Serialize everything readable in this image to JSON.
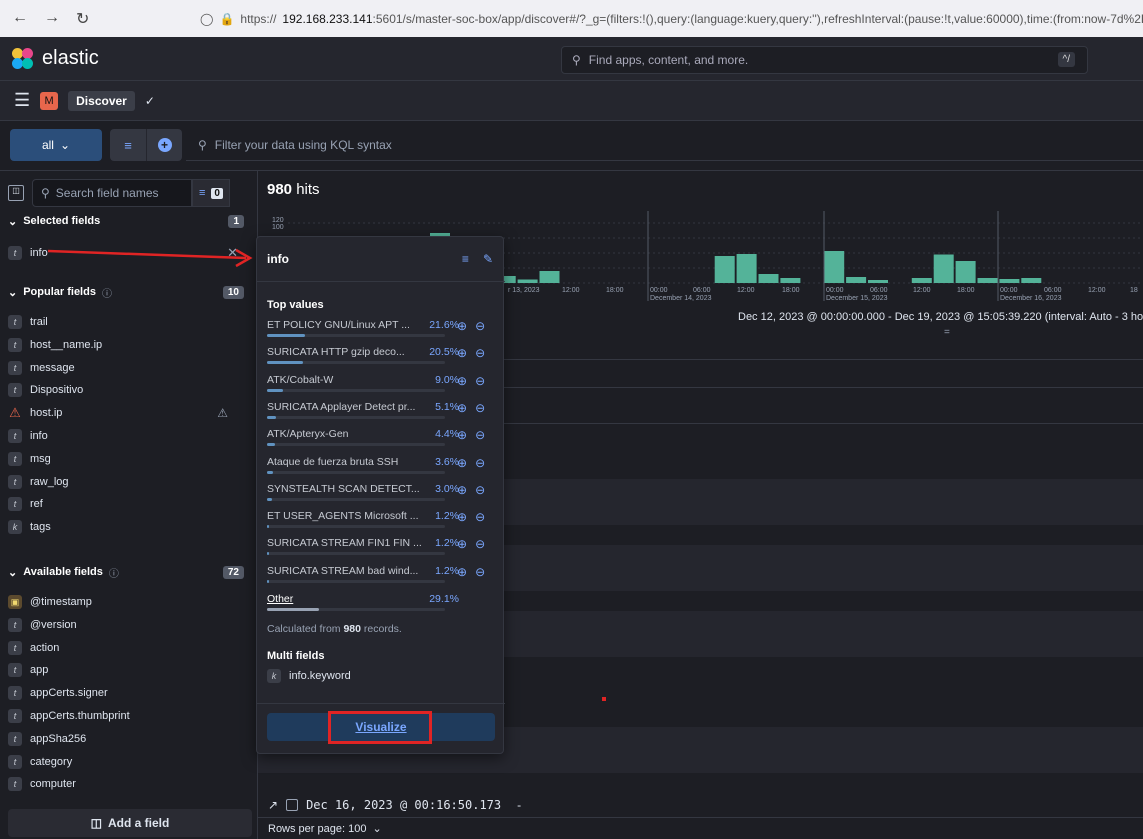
{
  "browser": {
    "url_prefix": "https://",
    "url_host": "192.168.233.141",
    "url_rest": ":5601/s/master-soc-box/app/discover#/?_g=(filters:!(),query:(language:kuery,query:''),refreshInterval:(pause:!t,value:60000),time:(from:now-7d%2Fd"
  },
  "header": {
    "logo_text": "elastic",
    "search_placeholder": "Find apps, content, and more.",
    "search_shortcut": "^/"
  },
  "breadcrumb": {
    "space_letter": "M",
    "app": "Discover"
  },
  "querybar": {
    "dataview": "all",
    "kql_placeholder": "Filter your data using KQL syntax"
  },
  "sidebar": {
    "search_placeholder": "Search field names",
    "filter_count": "0",
    "selected": {
      "title": "Selected fields",
      "count": "1",
      "fields": [
        {
          "type": "t",
          "name": "info"
        }
      ]
    },
    "popular": {
      "title": "Popular fields",
      "count": "10",
      "fields": [
        {
          "type": "t",
          "name": "trail"
        },
        {
          "type": "t",
          "name": "host__name.ip"
        },
        {
          "type": "t",
          "name": "message"
        },
        {
          "type": "t",
          "name": "Dispositivo"
        },
        {
          "type": "warn",
          "name": "host.ip"
        },
        {
          "type": "t",
          "name": "info"
        },
        {
          "type": "t",
          "name": "msg"
        },
        {
          "type": "t",
          "name": "raw_log"
        },
        {
          "type": "t",
          "name": "ref"
        },
        {
          "type": "k",
          "name": "tags"
        }
      ]
    },
    "available": {
      "title": "Available fields",
      "count": "72",
      "fields": [
        {
          "type": "date",
          "name": "@timestamp"
        },
        {
          "type": "t",
          "name": "@version"
        },
        {
          "type": "t",
          "name": "action"
        },
        {
          "type": "t",
          "name": "app"
        },
        {
          "type": "t",
          "name": "appCerts.signer"
        },
        {
          "type": "t",
          "name": "appCerts.thumbprint"
        },
        {
          "type": "t",
          "name": "appSha256"
        },
        {
          "type": "t",
          "name": "category"
        },
        {
          "type": "t",
          "name": "computer"
        }
      ]
    },
    "add_field": "Add a field"
  },
  "main": {
    "hits_count": "980",
    "hits_label": "hits",
    "time_range": "Dec 12, 2023 @ 00:00:00.000 - Dec 19, 2023 @ 15:05:39.220 (interval: Auto - 3 ho",
    "doc_timestamp": "Dec 16, 2023 @ 00:16:50.173",
    "doc_dash": "-",
    "rows_per_page": "Rows per page: 100"
  },
  "chart_data": {
    "type": "bar",
    "y_ticks": [
      "120",
      "100"
    ],
    "x_tick_labels": [
      "r 13, 2023",
      "12:00",
      "18:00",
      "00:00 December 14, 2023",
      "06:00",
      "12:00",
      "18:00",
      "00:00 December 15, 2023",
      "06:00",
      "12:00",
      "18:00",
      "00:00 December 16, 2023",
      "06:00",
      "12:00",
      "18"
    ],
    "values": [
      100,
      38,
      0,
      14,
      7,
      24,
      0,
      0,
      0,
      0,
      0,
      0,
      0,
      54,
      58,
      18,
      10,
      0,
      64,
      12,
      6,
      0,
      10,
      57,
      44,
      10,
      8,
      10,
      0,
      0,
      0,
      0
    ],
    "color": "#54b399"
  },
  "popover": {
    "title": "info",
    "top_values_title": "Top values",
    "top_values": [
      {
        "label": "ET POLICY GNU/Linux APT ...",
        "pct": "21.6%",
        "frac": 0.216
      },
      {
        "label": "SURICATA HTTP gzip deco...",
        "pct": "20.5%",
        "frac": 0.205
      },
      {
        "label": "ATK/Cobalt-W",
        "pct": "9.0%",
        "frac": 0.09
      },
      {
        "label": "SURICATA Applayer Detect pr...",
        "pct": "5.1%",
        "frac": 0.051
      },
      {
        "label": "ATK/Apteryx-Gen",
        "pct": "4.4%",
        "frac": 0.044
      },
      {
        "label": "Ataque de fuerza bruta SSH",
        "pct": "3.6%",
        "frac": 0.036
      },
      {
        "label": "SYNSTEALTH SCAN DETECT...",
        "pct": "3.0%",
        "frac": 0.03
      },
      {
        "label": "ET USER_AGENTS Microsoft ...",
        "pct": "1.2%",
        "frac": 0.012
      },
      {
        "label": "SURICATA STREAM FIN1 FIN ...",
        "pct": "1.2%",
        "frac": 0.012
      },
      {
        "label": "SURICATA STREAM bad wind...",
        "pct": "1.2%",
        "frac": 0.012
      }
    ],
    "other": {
      "label": "Other",
      "pct": "29.1%",
      "frac": 0.291
    },
    "calc_prefix": "Calculated from",
    "calc_count": "980",
    "calc_suffix": "records.",
    "multi_title": "Multi fields",
    "multi_field": "info.keyword",
    "visualize": "Visualize"
  }
}
